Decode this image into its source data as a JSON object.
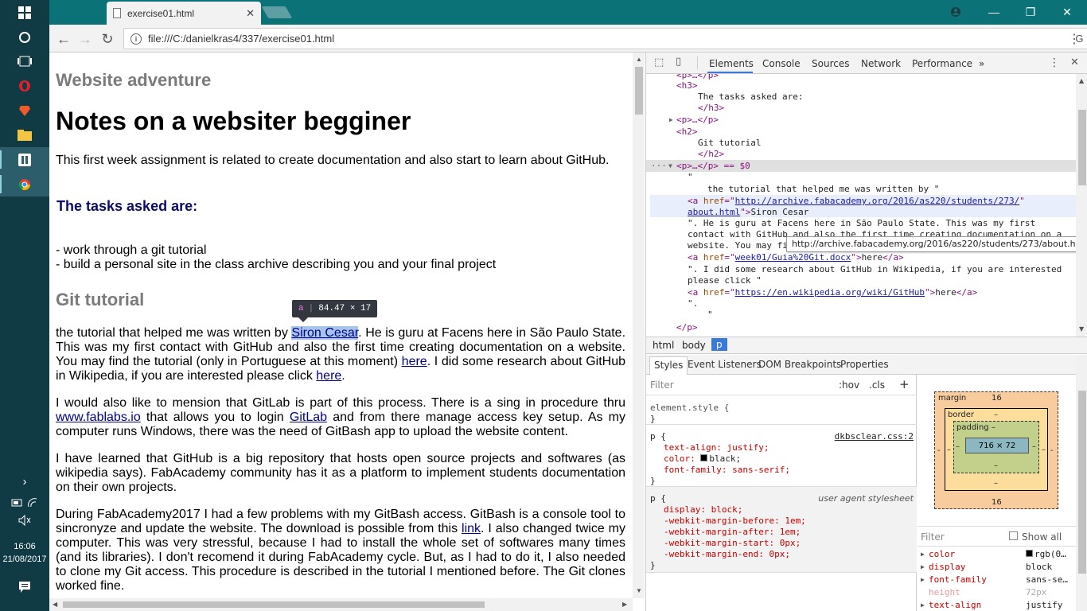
{
  "taskbar": {
    "time": "16:06",
    "date": "21/08/2017"
  },
  "browser": {
    "tab_title": "exercise01.html",
    "url": "file:///C:/danielkras4/337/exercise01.html"
  },
  "page": {
    "header": "Website adventure",
    "title": "Notes on a websiter begginer",
    "intro": "This first week assignment is related to create documentation and also start to learn about GitHub.",
    "tasks_heading": "The tasks asked are:",
    "task_1": "- work through a git tutorial",
    "task_2": "- build a personal site in the class archive describing you and your final project",
    "git_heading": "Git tutorial",
    "p1_a": "the tutorial that helped me was written by ",
    "p1_link": "Siron Cesar",
    "p1_b": ". He is guru at Facens here in São Paulo State. This was my first contact with GitHub and also the first time creating documentation on a website. You may find the tutorial (only in Portuguese at this moment) ",
    "p1_here1": "here",
    "p1_c": ". I did some research about GitHub in Wikipedia, if you are interested please click ",
    "p1_here2": "here",
    "p1_d": ".",
    "p2_a": "I would also like to mension that GitLab is part of this process. There is a sing in procedure thru ",
    "p2_link1": "www.fablabs.io",
    "p2_b": " that allows you to login ",
    "p2_link2": "GitLab",
    "p2_c": " and from there manage access key setup. As my computer runs Windows, there was the need of GitBash app to upload the website content.",
    "p3": "I have learned that GitHub is a big repository that hosts open source projects and softwares (as wikipedia says). FabAcademy community has it as a platform to implement students documentation on their own projects.",
    "p4_a": "During FabAcademy2017 I had a few problems with my GitBash access. GitBash is a console tool to sincronyze and update the website. The download is possible from this ",
    "p4_link": "link",
    "p4_b": ". I also changed twice my computer. This was very stressful, because I had to install the whole set of softwares many times (and its libraries). I don't recomend it during FabAcademy cycle. But, as I had to do it, I also needed to clone my Git access. This procedure is described in the tutorial I mentioned before. The Git clones worked fine.",
    "tooltip_tag": "a",
    "tooltip_size": "84.47 × 17"
  },
  "devtools": {
    "tabs": [
      "Elements",
      "Console",
      "Sources",
      "Network",
      "Performance"
    ],
    "more": "»",
    "dom": {
      "l0": "<p>…</p>",
      "h3_open": "<h3>",
      "h3_text": "The tasks asked are:",
      "h3_close": "</h3>",
      "p_collapsed": "<p>…</p>",
      "h2_open": "<h2>",
      "h2_text": "Git tutorial",
      "h2_close": "</h2>",
      "sel_line": "<p>…</p> == $0",
      "quote": "\"",
      "text1": "the tutorial that helped me was written by \"",
      "a1_href": "http://archive.fabacademy.org/2016/as220/students/273/",
      "a1_href2": "about.html",
      "a1_text": "Siron Cesar",
      "text2": "\". He is guru at Facens here in São Paulo State. This was my first",
      "text3": "contact with GitHub and also the first time creating documentation on a",
      "text4": "website. You may find the tutorial (only in Portuguese at this moment) \"",
      "a2_href": "week01/Guia%20Git.docx",
      "a2_text": "here",
      "text5": "\". I did some research about GitHub in Wikipedia, if you are interested",
      "text6": "please click \"",
      "a3_href": "https://en.wikipedia.org/wiki/GitHub",
      "a3_text": "here",
      "text7": "\".",
      "text8": "\"",
      "p_close": "</p>",
      "url_tooltip": "http://archive.fabacademy.org/2016/as220/students/273/about.html"
    },
    "breadcrumbs": [
      "html",
      "body",
      "p"
    ],
    "subtabs": [
      "Styles",
      "Event Listeners",
      "DOM Breakpoints",
      "Properties"
    ],
    "styles": {
      "filter_placeholder": "Filter",
      "hov": ":hov",
      "cls": ".cls",
      "plus": "+",
      "element_style": "element.style {",
      "close": "}",
      "rule1_selector": "p {",
      "rule1_source": "dkbsclear.css:2",
      "rule1_props": [
        "text-align: justify;",
        "color: black;",
        "font-family: sans-serif;"
      ],
      "rule2_selector": "p {",
      "rule2_source": "user agent stylesheet",
      "rule2_props": [
        "display: block;",
        "-webkit-margin-before: 1em;",
        "-webkit-margin-after: 1em;",
        "-webkit-margin-start: 0px;",
        "-webkit-margin-end: 0px;"
      ]
    },
    "box_model": {
      "margin_label": "margin",
      "margin_top": "16",
      "margin_bottom": "16",
      "margin_side": "-",
      "border_label": "border",
      "border_value": "–",
      "padding_label": "padding",
      "padding_value": "–",
      "content": "716 × 72"
    },
    "computed": {
      "filter_placeholder": "Filter",
      "show_all": "Show all",
      "props": [
        {
          "name": "color",
          "value": "rgb(0…"
        },
        {
          "name": "display",
          "value": "block"
        },
        {
          "name": "font-family",
          "value": "sans-se…"
        },
        {
          "name": "height",
          "value": "72px"
        },
        {
          "name": "text-align",
          "value": "justify"
        }
      ]
    }
  },
  "colors": {
    "titlebar": "#0b7378",
    "taskbar": "#103a44",
    "link": "#00008b",
    "tasks_heading": "#0b0b6e",
    "accent": "#3879d9"
  }
}
